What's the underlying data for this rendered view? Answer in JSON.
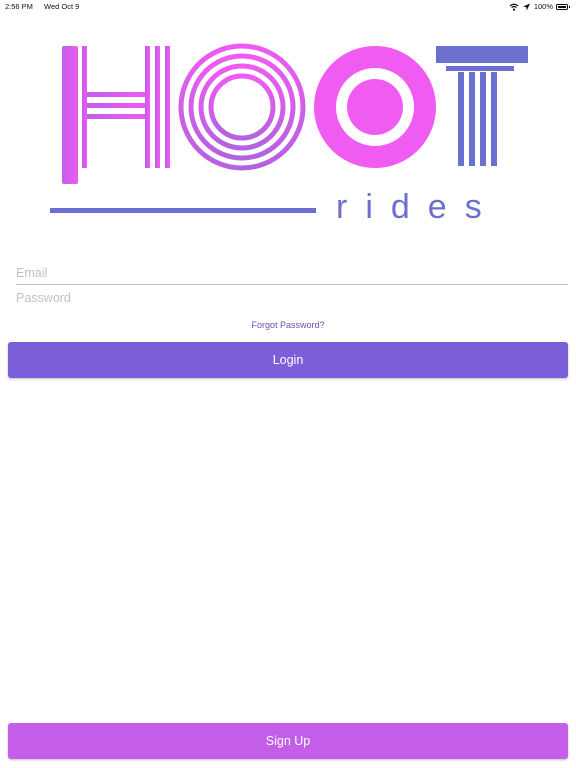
{
  "status_bar": {
    "time": "2:56 PM",
    "date": "Wed Oct 9",
    "battery": "100%",
    "icons": [
      "wifi-icon",
      "location-arrow-icon",
      "battery-icon"
    ]
  },
  "logo": {
    "subtitle": "rides"
  },
  "form": {
    "email_placeholder": "Email",
    "password_placeholder": "Password",
    "forgot_label": "Forgot Password?",
    "login_label": "Login"
  },
  "footer": {
    "signup_label": "Sign Up"
  },
  "colors": {
    "pink": "#f05bf2",
    "purple": "#b062df",
    "indigo": "#6b6fcf",
    "login_button": "#7a5fd9",
    "signup_button": "#c45ee8",
    "link": "#6e4bb9"
  }
}
